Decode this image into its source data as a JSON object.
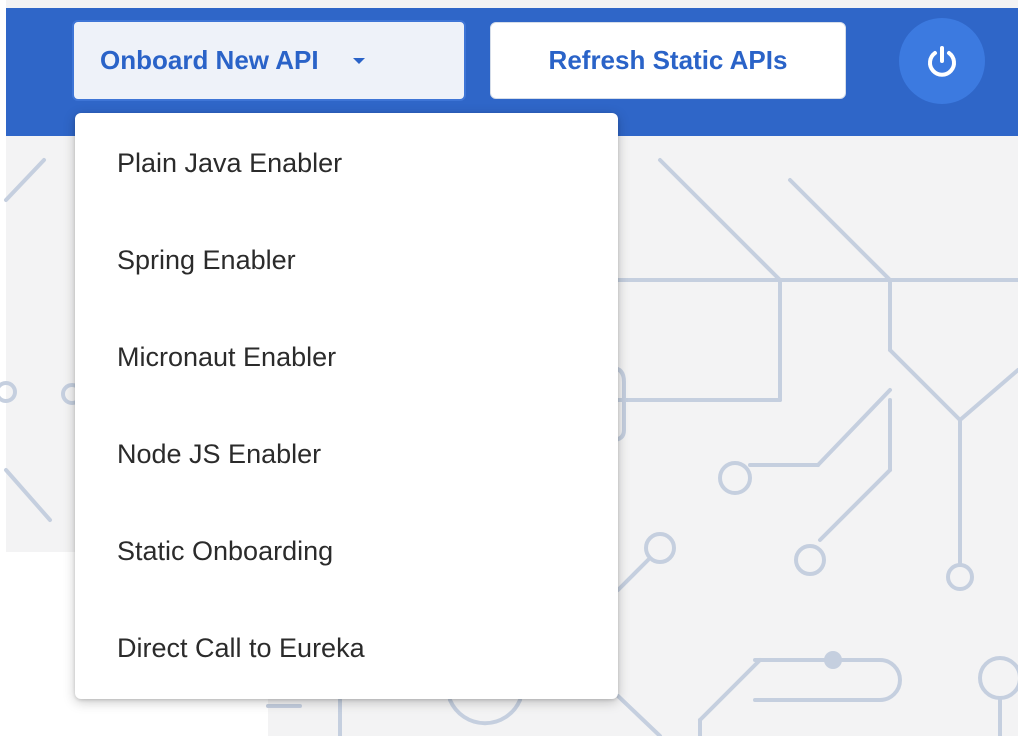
{
  "header": {
    "onboard_label": "Onboard New API",
    "refresh_label": "Refresh Static APIs",
    "accent_color": "#2f66c8"
  },
  "onboard_menu": {
    "items": [
      "Plain Java Enabler",
      "Spring Enabler",
      "Micronaut Enabler",
      "Node JS Enabler",
      "Static Onboarding",
      "Direct Call to Eureka"
    ]
  },
  "icons": {
    "dropdown": "chevron-down-icon",
    "power": "power-icon"
  }
}
